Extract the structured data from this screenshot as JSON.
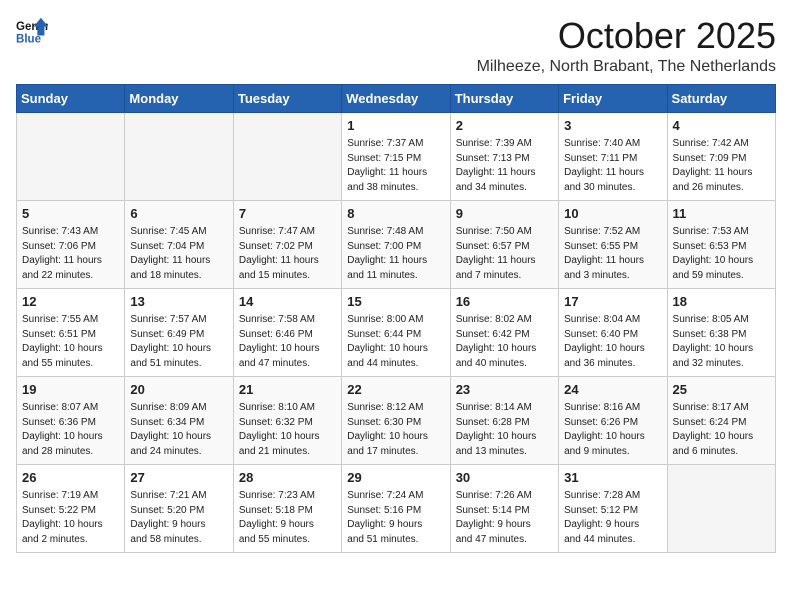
{
  "header": {
    "logo_general": "General",
    "logo_blue": "Blue",
    "month": "October 2025",
    "location": "Milheeze, North Brabant, The Netherlands"
  },
  "weekdays": [
    "Sunday",
    "Monday",
    "Tuesday",
    "Wednesday",
    "Thursday",
    "Friday",
    "Saturday"
  ],
  "weeks": [
    [
      {
        "day": "",
        "info": "",
        "empty": true
      },
      {
        "day": "",
        "info": "",
        "empty": true
      },
      {
        "day": "",
        "info": "",
        "empty": true
      },
      {
        "day": "1",
        "info": "Sunrise: 7:37 AM\nSunset: 7:15 PM\nDaylight: 11 hours\nand 38 minutes."
      },
      {
        "day": "2",
        "info": "Sunrise: 7:39 AM\nSunset: 7:13 PM\nDaylight: 11 hours\nand 34 minutes."
      },
      {
        "day": "3",
        "info": "Sunrise: 7:40 AM\nSunset: 7:11 PM\nDaylight: 11 hours\nand 30 minutes."
      },
      {
        "day": "4",
        "info": "Sunrise: 7:42 AM\nSunset: 7:09 PM\nDaylight: 11 hours\nand 26 minutes."
      }
    ],
    [
      {
        "day": "5",
        "info": "Sunrise: 7:43 AM\nSunset: 7:06 PM\nDaylight: 11 hours\nand 22 minutes."
      },
      {
        "day": "6",
        "info": "Sunrise: 7:45 AM\nSunset: 7:04 PM\nDaylight: 11 hours\nand 18 minutes."
      },
      {
        "day": "7",
        "info": "Sunrise: 7:47 AM\nSunset: 7:02 PM\nDaylight: 11 hours\nand 15 minutes."
      },
      {
        "day": "8",
        "info": "Sunrise: 7:48 AM\nSunset: 7:00 PM\nDaylight: 11 hours\nand 11 minutes."
      },
      {
        "day": "9",
        "info": "Sunrise: 7:50 AM\nSunset: 6:57 PM\nDaylight: 11 hours\nand 7 minutes."
      },
      {
        "day": "10",
        "info": "Sunrise: 7:52 AM\nSunset: 6:55 PM\nDaylight: 11 hours\nand 3 minutes."
      },
      {
        "day": "11",
        "info": "Sunrise: 7:53 AM\nSunset: 6:53 PM\nDaylight: 10 hours\nand 59 minutes."
      }
    ],
    [
      {
        "day": "12",
        "info": "Sunrise: 7:55 AM\nSunset: 6:51 PM\nDaylight: 10 hours\nand 55 minutes."
      },
      {
        "day": "13",
        "info": "Sunrise: 7:57 AM\nSunset: 6:49 PM\nDaylight: 10 hours\nand 51 minutes."
      },
      {
        "day": "14",
        "info": "Sunrise: 7:58 AM\nSunset: 6:46 PM\nDaylight: 10 hours\nand 47 minutes."
      },
      {
        "day": "15",
        "info": "Sunrise: 8:00 AM\nSunset: 6:44 PM\nDaylight: 10 hours\nand 44 minutes."
      },
      {
        "day": "16",
        "info": "Sunrise: 8:02 AM\nSunset: 6:42 PM\nDaylight: 10 hours\nand 40 minutes."
      },
      {
        "day": "17",
        "info": "Sunrise: 8:04 AM\nSunset: 6:40 PM\nDaylight: 10 hours\nand 36 minutes."
      },
      {
        "day": "18",
        "info": "Sunrise: 8:05 AM\nSunset: 6:38 PM\nDaylight: 10 hours\nand 32 minutes."
      }
    ],
    [
      {
        "day": "19",
        "info": "Sunrise: 8:07 AM\nSunset: 6:36 PM\nDaylight: 10 hours\nand 28 minutes."
      },
      {
        "day": "20",
        "info": "Sunrise: 8:09 AM\nSunset: 6:34 PM\nDaylight: 10 hours\nand 24 minutes."
      },
      {
        "day": "21",
        "info": "Sunrise: 8:10 AM\nSunset: 6:32 PM\nDaylight: 10 hours\nand 21 minutes."
      },
      {
        "day": "22",
        "info": "Sunrise: 8:12 AM\nSunset: 6:30 PM\nDaylight: 10 hours\nand 17 minutes."
      },
      {
        "day": "23",
        "info": "Sunrise: 8:14 AM\nSunset: 6:28 PM\nDaylight: 10 hours\nand 13 minutes."
      },
      {
        "day": "24",
        "info": "Sunrise: 8:16 AM\nSunset: 6:26 PM\nDaylight: 10 hours\nand 9 minutes."
      },
      {
        "day": "25",
        "info": "Sunrise: 8:17 AM\nSunset: 6:24 PM\nDaylight: 10 hours\nand 6 minutes."
      }
    ],
    [
      {
        "day": "26",
        "info": "Sunrise: 7:19 AM\nSunset: 5:22 PM\nDaylight: 10 hours\nand 2 minutes."
      },
      {
        "day": "27",
        "info": "Sunrise: 7:21 AM\nSunset: 5:20 PM\nDaylight: 9 hours\nand 58 minutes."
      },
      {
        "day": "28",
        "info": "Sunrise: 7:23 AM\nSunset: 5:18 PM\nDaylight: 9 hours\nand 55 minutes."
      },
      {
        "day": "29",
        "info": "Sunrise: 7:24 AM\nSunset: 5:16 PM\nDaylight: 9 hours\nand 51 minutes."
      },
      {
        "day": "30",
        "info": "Sunrise: 7:26 AM\nSunset: 5:14 PM\nDaylight: 9 hours\nand 47 minutes."
      },
      {
        "day": "31",
        "info": "Sunrise: 7:28 AM\nSunset: 5:12 PM\nDaylight: 9 hours\nand 44 minutes."
      },
      {
        "day": "",
        "info": "",
        "empty": true
      }
    ]
  ]
}
